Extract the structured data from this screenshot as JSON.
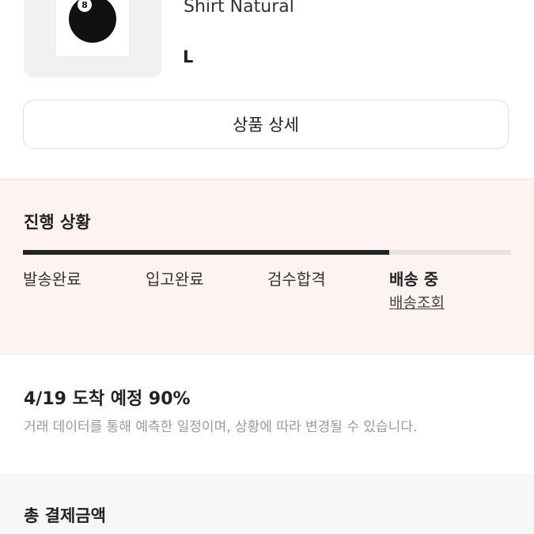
{
  "product": {
    "name": "Shirt Natural",
    "size": "L",
    "image_icon": "tshirt-eight-ball-image"
  },
  "detail_button_label": "상품 상세",
  "progress": {
    "title": "진행 상황",
    "fraction_complete": 0.75,
    "steps": [
      {
        "label": "발송완료"
      },
      {
        "label": "입고완료"
      },
      {
        "label": "검수합격"
      },
      {
        "label": "배송 중",
        "active": true
      }
    ],
    "tracking_link": "배송조회"
  },
  "eta": {
    "title": "4/19 도착 예정 90%",
    "note": "거래 데이터를 통해 예측한 일정이며, 상황에 따라 변경될 수 있습니다."
  },
  "payment": {
    "total_label": "총 결제금액"
  },
  "colors": {
    "progress_bg": "#fdf3f1",
    "progress_fill": "#222222",
    "muted_text": "#9a9a9a"
  }
}
